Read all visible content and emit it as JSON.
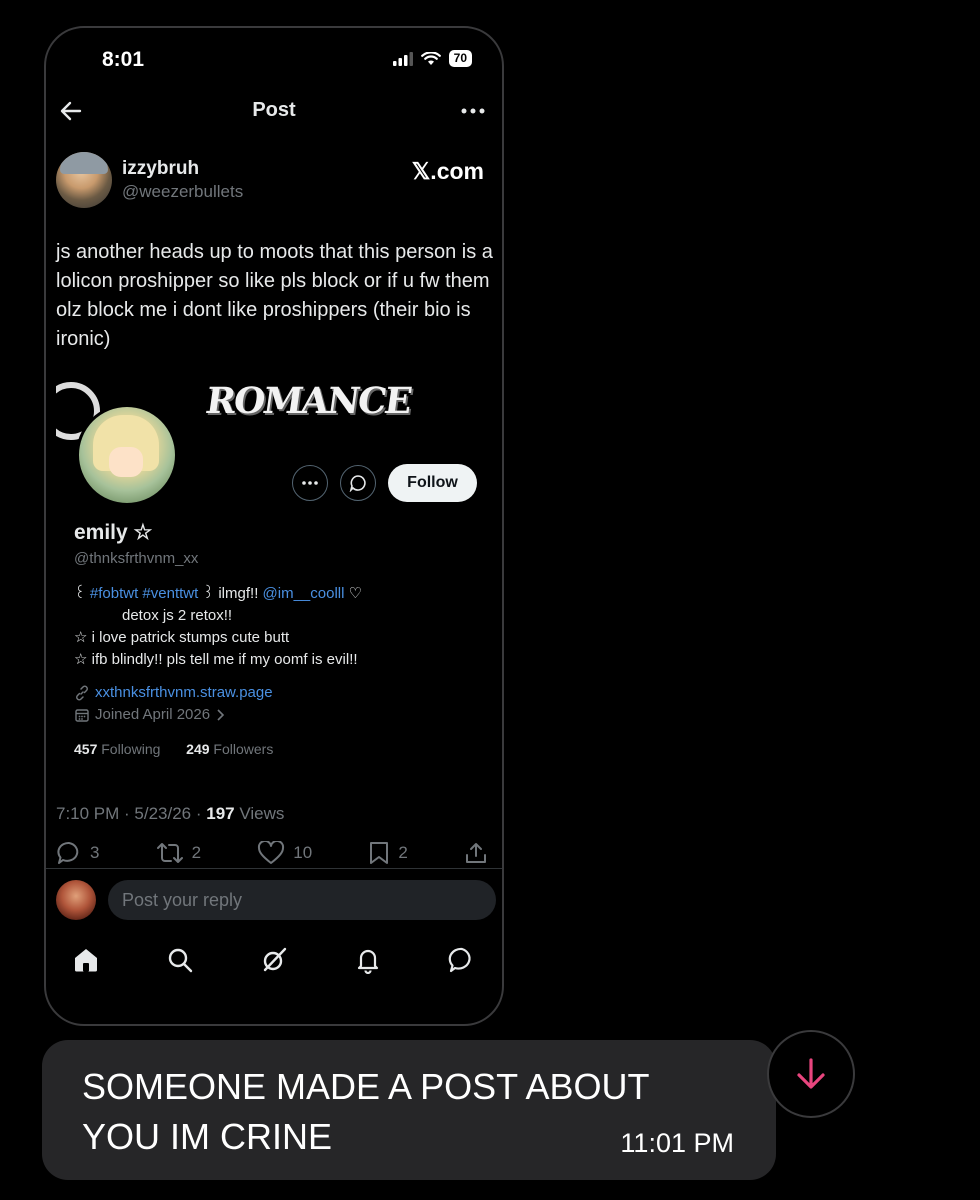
{
  "status_bar": {
    "time": "8:01",
    "battery": "70"
  },
  "header": {
    "title": "Post"
  },
  "post": {
    "display_name": "izzybruh",
    "handle": "@weezerbullets",
    "source_label": "𝕏.com",
    "text": "js another heads up to moots that this person is a lolicon proshipper so like pls block or if u fw them olz block me i dont like proshippers (their bio is ironic)",
    "timestamp": "7:10 PM · 5/23/26 · ",
    "views_count": "197",
    "views_label": " Views",
    "replies": "3",
    "reposts": "2",
    "likes": "10",
    "bookmarks": "2"
  },
  "embedded_profile": {
    "banner_text": "ROMANCE",
    "follow_label": "Follow",
    "name": "emily ☆",
    "handle": "@thnksfrthvnm_xx",
    "bio_prefix": "꒰ ",
    "bio_tags": "#fobtwt #venttwt",
    "bio_mid": " ꒱ ilmgf!! ",
    "bio_mention": "@im__coolll",
    "bio_heart": " ♡",
    "bio_line2": "detox js 2 retox!!",
    "bio_line3": "☆ i love patrick stumps cute butt",
    "bio_line4": "☆ ifb blindly!! pls tell me if my oomf is evil!!",
    "url": "xxthnksfrthvnm.straw.page",
    "joined": "Joined April 2026",
    "following_count": "457",
    "following_label": "Following",
    "followers_count": "249",
    "followers_label": "Followers"
  },
  "reply": {
    "placeholder": "Post your reply"
  },
  "message": {
    "text": "SOMEONE MADE A POST ABOUT YOU IM CRINE",
    "time": "11:01 PM"
  },
  "colors": {
    "accent": "#4a90e2",
    "scroll_arrow": "#e8457e",
    "bubble": "#262628"
  }
}
